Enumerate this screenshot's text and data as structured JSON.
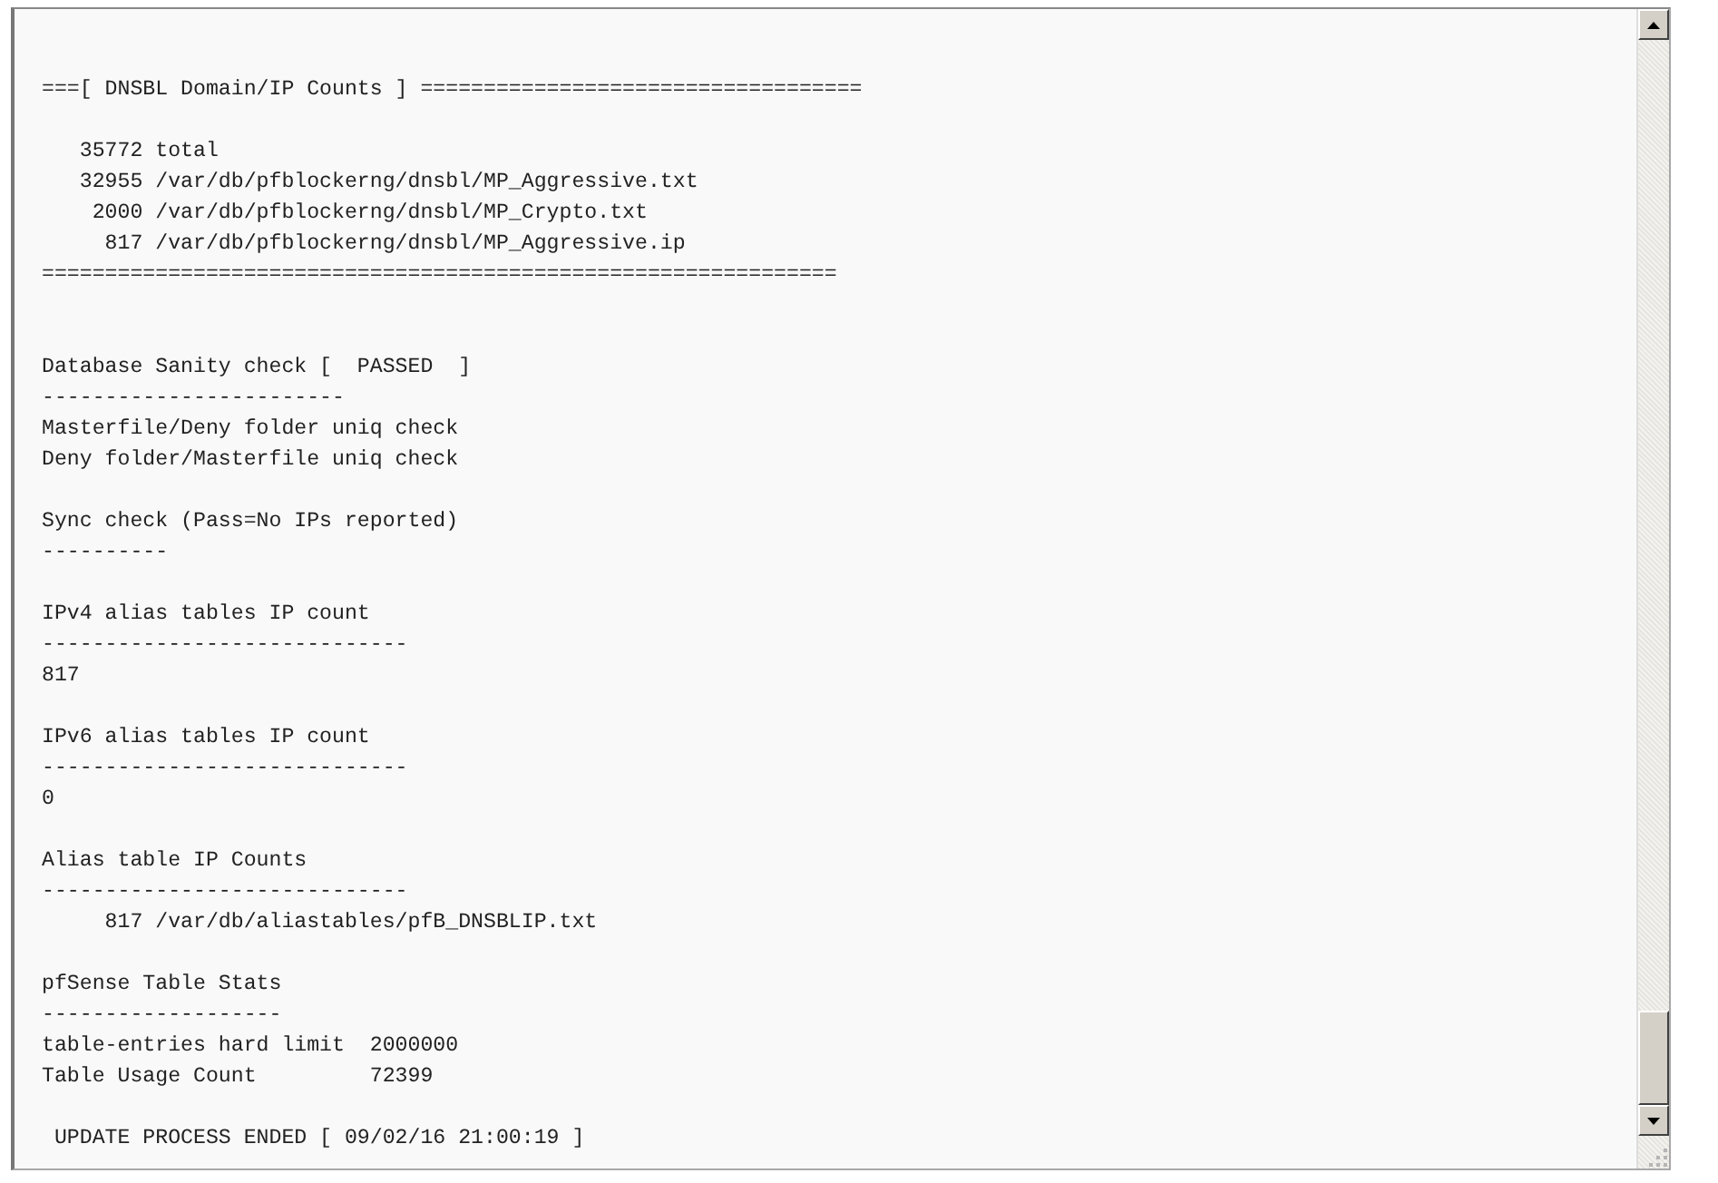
{
  "log": {
    "blocks": [
      {
        "lines": [
          "===[ DNSBL Domain/IP Counts ] ==================================="
        ]
      },
      {
        "lines": [
          "   35772 total",
          "   32955 /var/db/pfblockerng/dnsbl/MP_Aggressive.txt",
          "    2000 /var/db/pfblockerng/dnsbl/MP_Crypto.txt",
          "     817 /var/db/pfblockerng/dnsbl/MP_Aggressive.ip",
          "==============================================================="
        ]
      },
      {
        "lines": [
          "Database Sanity check [  PASSED  ]",
          "------------------------",
          "Masterfile/Deny folder uniq check",
          "Deny folder/Masterfile uniq check"
        ]
      },
      {
        "lines": [
          "Sync check (Pass=No IPs reported)",
          "----------"
        ]
      },
      {
        "lines": [
          "IPv4 alias tables IP count",
          "-----------------------------",
          "817"
        ]
      },
      {
        "lines": [
          "IPv6 alias tables IP count",
          "-----------------------------",
          "0"
        ]
      },
      {
        "lines": [
          "Alias table IP Counts",
          "-----------------------------",
          "     817 /var/db/aliastables/pfB_DNSBLIP.txt"
        ]
      },
      {
        "lines": [
          "pfSense Table Stats",
          "-------------------",
          "table-entries hard limit  2000000",
          "Table Usage Count         72399"
        ]
      },
      {
        "lines": [
          " UPDATE PROCESS ENDED [ 09/02/16 21:00:19 ]"
        ]
      }
    ]
  }
}
